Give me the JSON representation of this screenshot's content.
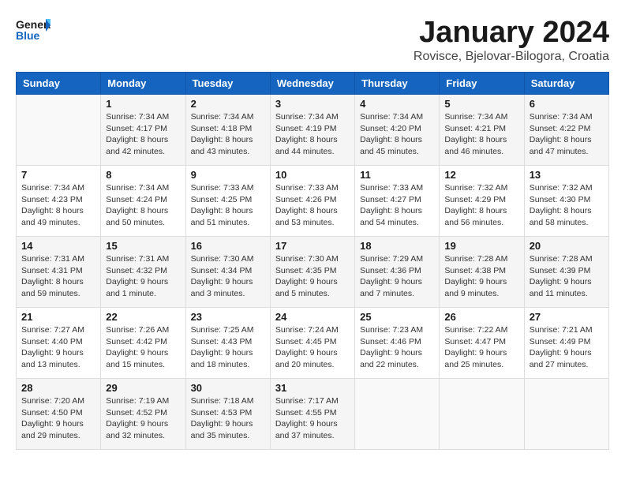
{
  "logo": {
    "general": "General",
    "blue": "Blue"
  },
  "title": "January 2024",
  "location": "Rovisce, Bjelovar-Bilogora, Croatia",
  "days_of_week": [
    "Sunday",
    "Monday",
    "Tuesday",
    "Wednesday",
    "Thursday",
    "Friday",
    "Saturday"
  ],
  "weeks": [
    [
      {
        "day": "",
        "content": ""
      },
      {
        "day": "1",
        "content": "Sunrise: 7:34 AM\nSunset: 4:17 PM\nDaylight: 8 hours\nand 42 minutes."
      },
      {
        "day": "2",
        "content": "Sunrise: 7:34 AM\nSunset: 4:18 PM\nDaylight: 8 hours\nand 43 minutes."
      },
      {
        "day": "3",
        "content": "Sunrise: 7:34 AM\nSunset: 4:19 PM\nDaylight: 8 hours\nand 44 minutes."
      },
      {
        "day": "4",
        "content": "Sunrise: 7:34 AM\nSunset: 4:20 PM\nDaylight: 8 hours\nand 45 minutes."
      },
      {
        "day": "5",
        "content": "Sunrise: 7:34 AM\nSunset: 4:21 PM\nDaylight: 8 hours\nand 46 minutes."
      },
      {
        "day": "6",
        "content": "Sunrise: 7:34 AM\nSunset: 4:22 PM\nDaylight: 8 hours\nand 47 minutes."
      }
    ],
    [
      {
        "day": "7",
        "content": "Sunrise: 7:34 AM\nSunset: 4:23 PM\nDaylight: 8 hours\nand 49 minutes."
      },
      {
        "day": "8",
        "content": "Sunrise: 7:34 AM\nSunset: 4:24 PM\nDaylight: 8 hours\nand 50 minutes."
      },
      {
        "day": "9",
        "content": "Sunrise: 7:33 AM\nSunset: 4:25 PM\nDaylight: 8 hours\nand 51 minutes."
      },
      {
        "day": "10",
        "content": "Sunrise: 7:33 AM\nSunset: 4:26 PM\nDaylight: 8 hours\nand 53 minutes."
      },
      {
        "day": "11",
        "content": "Sunrise: 7:33 AM\nSunset: 4:27 PM\nDaylight: 8 hours\nand 54 minutes."
      },
      {
        "day": "12",
        "content": "Sunrise: 7:32 AM\nSunset: 4:29 PM\nDaylight: 8 hours\nand 56 minutes."
      },
      {
        "day": "13",
        "content": "Sunrise: 7:32 AM\nSunset: 4:30 PM\nDaylight: 8 hours\nand 58 minutes."
      }
    ],
    [
      {
        "day": "14",
        "content": "Sunrise: 7:31 AM\nSunset: 4:31 PM\nDaylight: 8 hours\nand 59 minutes."
      },
      {
        "day": "15",
        "content": "Sunrise: 7:31 AM\nSunset: 4:32 PM\nDaylight: 9 hours\nand 1 minute."
      },
      {
        "day": "16",
        "content": "Sunrise: 7:30 AM\nSunset: 4:34 PM\nDaylight: 9 hours\nand 3 minutes."
      },
      {
        "day": "17",
        "content": "Sunrise: 7:30 AM\nSunset: 4:35 PM\nDaylight: 9 hours\nand 5 minutes."
      },
      {
        "day": "18",
        "content": "Sunrise: 7:29 AM\nSunset: 4:36 PM\nDaylight: 9 hours\nand 7 minutes."
      },
      {
        "day": "19",
        "content": "Sunrise: 7:28 AM\nSunset: 4:38 PM\nDaylight: 9 hours\nand 9 minutes."
      },
      {
        "day": "20",
        "content": "Sunrise: 7:28 AM\nSunset: 4:39 PM\nDaylight: 9 hours\nand 11 minutes."
      }
    ],
    [
      {
        "day": "21",
        "content": "Sunrise: 7:27 AM\nSunset: 4:40 PM\nDaylight: 9 hours\nand 13 minutes."
      },
      {
        "day": "22",
        "content": "Sunrise: 7:26 AM\nSunset: 4:42 PM\nDaylight: 9 hours\nand 15 minutes."
      },
      {
        "day": "23",
        "content": "Sunrise: 7:25 AM\nSunset: 4:43 PM\nDaylight: 9 hours\nand 18 minutes."
      },
      {
        "day": "24",
        "content": "Sunrise: 7:24 AM\nSunset: 4:45 PM\nDaylight: 9 hours\nand 20 minutes."
      },
      {
        "day": "25",
        "content": "Sunrise: 7:23 AM\nSunset: 4:46 PM\nDaylight: 9 hours\nand 22 minutes."
      },
      {
        "day": "26",
        "content": "Sunrise: 7:22 AM\nSunset: 4:47 PM\nDaylight: 9 hours\nand 25 minutes."
      },
      {
        "day": "27",
        "content": "Sunrise: 7:21 AM\nSunset: 4:49 PM\nDaylight: 9 hours\nand 27 minutes."
      }
    ],
    [
      {
        "day": "28",
        "content": "Sunrise: 7:20 AM\nSunset: 4:50 PM\nDaylight: 9 hours\nand 29 minutes."
      },
      {
        "day": "29",
        "content": "Sunrise: 7:19 AM\nSunset: 4:52 PM\nDaylight: 9 hours\nand 32 minutes."
      },
      {
        "day": "30",
        "content": "Sunrise: 7:18 AM\nSunset: 4:53 PM\nDaylight: 9 hours\nand 35 minutes."
      },
      {
        "day": "31",
        "content": "Sunrise: 7:17 AM\nSunset: 4:55 PM\nDaylight: 9 hours\nand 37 minutes."
      },
      {
        "day": "",
        "content": ""
      },
      {
        "day": "",
        "content": ""
      },
      {
        "day": "",
        "content": ""
      }
    ]
  ]
}
